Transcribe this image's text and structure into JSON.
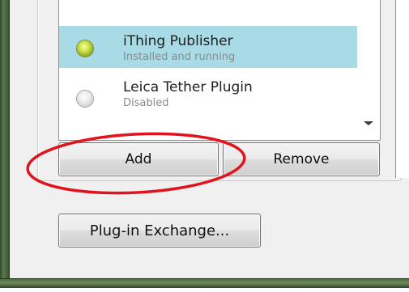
{
  "plugins": [
    {
      "name": "iThing Publisher",
      "status": "Installed and running",
      "selected": true,
      "indicator": "green-light-icon"
    },
    {
      "name": "Leica Tether Plugin",
      "status": "Disabled",
      "selected": false,
      "indicator": "gray-light-icon"
    }
  ],
  "buttons": {
    "add": "Add",
    "remove": "Remove",
    "exchange": "Plug-in Exchange..."
  },
  "colors": {
    "selection": "#a9dbe6",
    "annotation": "#e0141e"
  }
}
